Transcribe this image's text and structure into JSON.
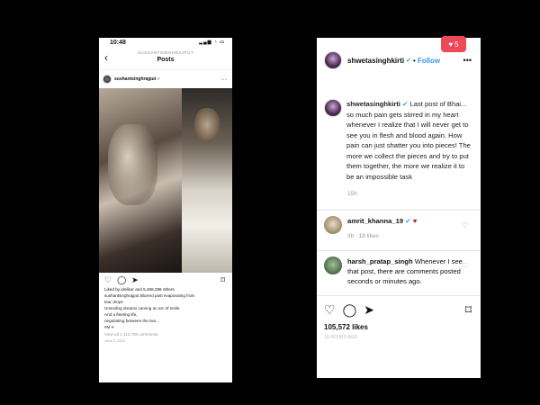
{
  "left_post": {
    "status_time": "10:48",
    "header_handle": "SUSHANTSINGHRAJPUT",
    "header_title": "Posts",
    "username": "sushantsinghrajput",
    "liked_by": "Liked by idelikar and 5,468,396 others",
    "caption_lines": [
      "sushantsinghrajput Blurred past evaporating from",
      "tear drops",
      "Unending dreams carving an arc of smile",
      "And a fleeting life,",
      "negotiating between the two...",
      "#M"
    ],
    "view_comments": "View all 1,113,766 comments",
    "date": "June 3, 2020"
  },
  "right_post": {
    "notification_count": "5",
    "username": "shwetasinghkirti",
    "follow_label": "Follow",
    "caption_username": "shwetasinghkirti",
    "caption_text": "Last post of Bhai... so much pain gets stirred in my heart whenever I realize that I will never get to see you in flesh and blood again. How pain can just shatter you into pieces! The more we collect the pieces and try to put them together, the more we realize it to be an impossible task",
    "caption_time": "15h",
    "comments": [
      {
        "username": "amrit_khanna_19",
        "text": "",
        "time": "3h",
        "likes": "18 likes"
      },
      {
        "username": "harsh_pratap_singh",
        "text": "Whenever I see that post, there are comments posted seconds or minutes ago.",
        "time": "",
        "likes": ""
      }
    ],
    "likes_count": "105,572 likes",
    "date": "15 HOURS AGO"
  }
}
